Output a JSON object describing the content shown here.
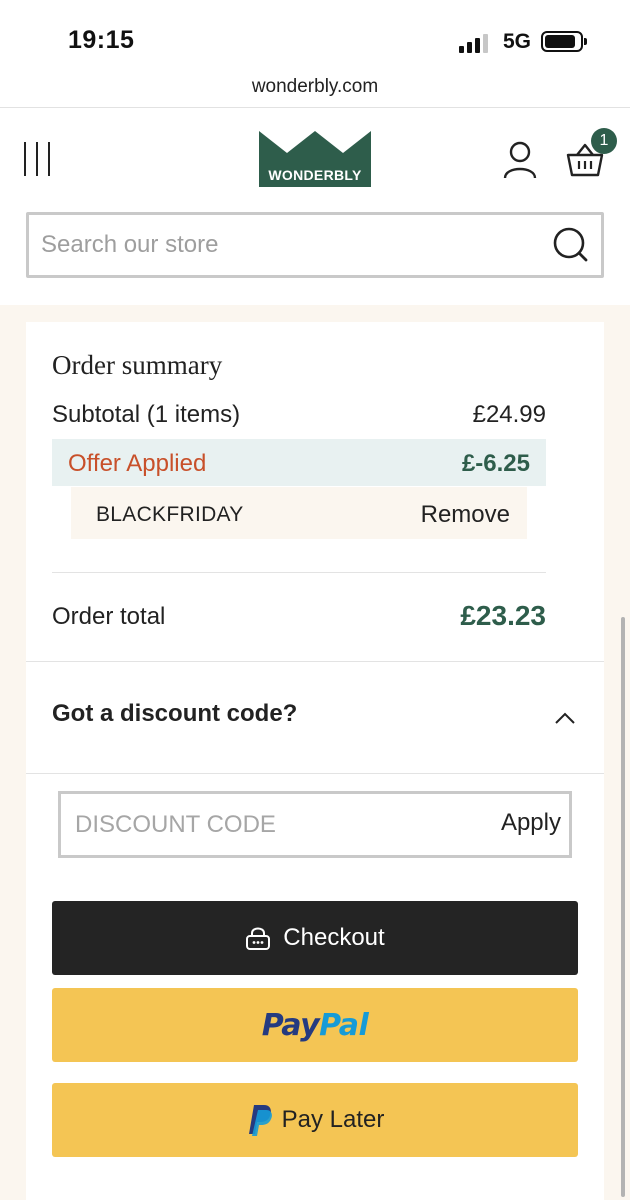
{
  "status_bar": {
    "time": "19:15",
    "network": "5G"
  },
  "browser": {
    "url": "wonderbly.com"
  },
  "header": {
    "logo_text": "WONDERBLY",
    "cart_count": "1",
    "search_placeholder": "Search our store"
  },
  "order_summary": {
    "title": "Order summary",
    "subtotal_label": "Subtotal (1 items)",
    "subtotal_value": "£24.99",
    "offer_label": "Offer Applied",
    "offer_value": "£-6.25",
    "code_name": "BLACKFRIDAY",
    "remove_label": "Remove",
    "total_label": "Order total",
    "total_value": "£23.23"
  },
  "discount": {
    "title": "Got a discount code?",
    "placeholder": "DISCOUNT CODE",
    "apply_label": "Apply"
  },
  "buttons": {
    "checkout_label": "Checkout",
    "paypal_pay": "Pay",
    "paypal_pal": "Pal",
    "pay_later_label": "Pay Later"
  },
  "colors": {
    "brand_green": "#2e5d4b",
    "offer_orange": "#c8502a",
    "checkout_black": "#242424",
    "paypal_yellow": "#f4c554",
    "page_cream": "#fbf6ef"
  },
  "icons": [
    "signal-icon",
    "battery-icon",
    "menu-icon",
    "user-icon",
    "basket-icon",
    "search-icon",
    "chevron-up-icon",
    "lock-icon",
    "paypal-icon"
  ]
}
